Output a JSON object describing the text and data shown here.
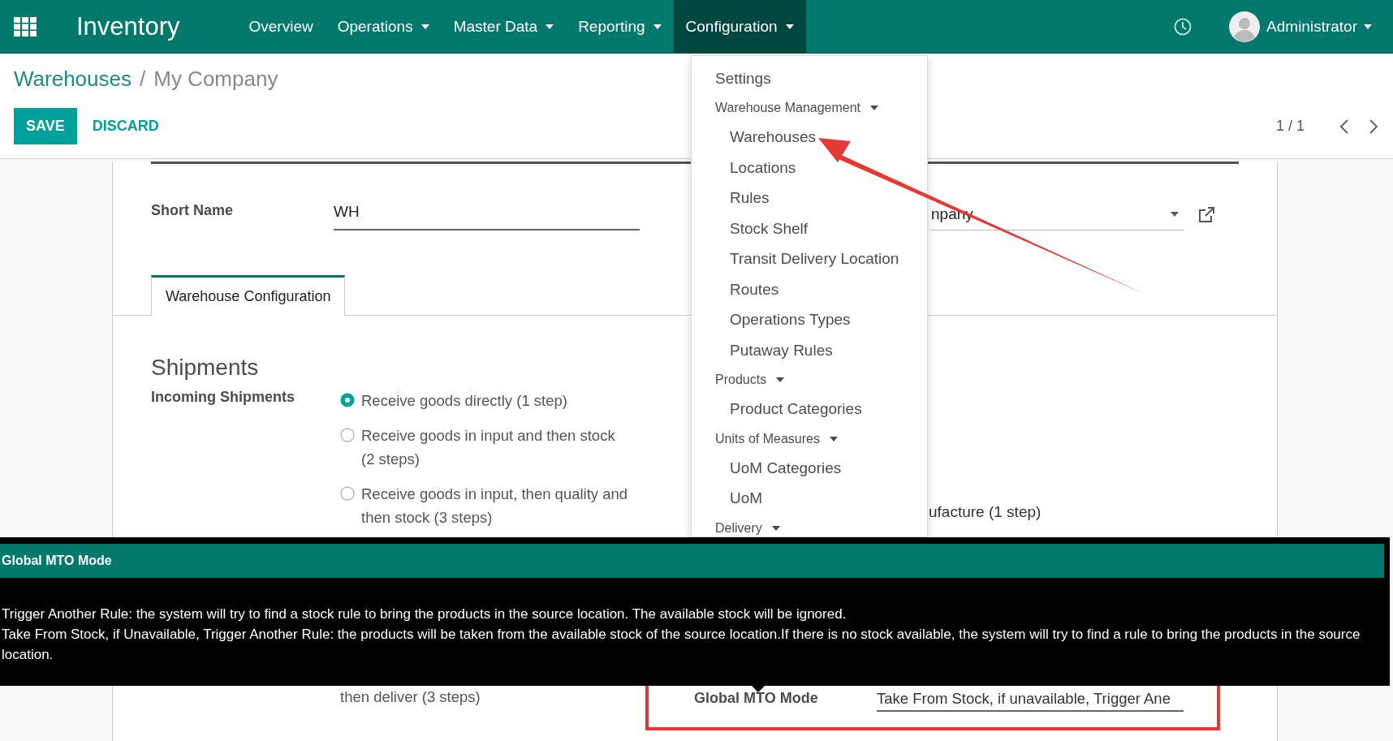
{
  "navbar": {
    "app_name": "Inventory",
    "menu": [
      {
        "label": "Overview",
        "has_caret": false,
        "selected": false
      },
      {
        "label": "Operations",
        "has_caret": true,
        "selected": false
      },
      {
        "label": "Master Data",
        "has_caret": true,
        "selected": false
      },
      {
        "label": "Reporting",
        "has_caret": true,
        "selected": false
      },
      {
        "label": "Configuration",
        "has_caret": true,
        "selected": true
      }
    ],
    "user": "Administrator"
  },
  "breadcrumb": {
    "parent": "Warehouses",
    "separator": "/",
    "current": "My Company"
  },
  "buttons": [
    {
      "label": "SAVE",
      "kind": "primary"
    },
    {
      "label": "DISCARD",
      "kind": "link"
    }
  ],
  "pager": "1 / 1",
  "form": {
    "short_name_label": "Short Name",
    "short_name_value": "WH",
    "company_value": "npany",
    "tabs": [
      {
        "label": "Warehouse Configuration",
        "selected": true
      }
    ],
    "section_title": "Shipments",
    "incoming_label": "Incoming Shipments",
    "incoming_options": [
      {
        "label": "Receive goods directly (1 step)",
        "selected": true
      },
      {
        "label": "Receive goods in input and then stock (2 steps)",
        "selected": false
      },
      {
        "label": "Receive goods in input, then quality and then stock (3 steps)",
        "selected": false
      }
    ],
    "manufacture_option": "ufacture (1 step)",
    "outgoing_option_tail": "then deliver (3 steps)",
    "mto_label": "Global MTO Mode",
    "mto_value": "Take From Stock, if unavailable, Trigger Ane"
  },
  "dropdown": {
    "items": [
      {
        "label": "Settings",
        "kind": "item"
      },
      {
        "label": "Warehouse Management",
        "kind": "header"
      },
      {
        "label": "Warehouses",
        "kind": "subitem"
      },
      {
        "label": "Locations",
        "kind": "subitem"
      },
      {
        "label": "Rules",
        "kind": "subitem"
      },
      {
        "label": "Stock Shelf",
        "kind": "subitem"
      },
      {
        "label": "Transit Delivery Location",
        "kind": "subitem"
      },
      {
        "label": "Routes",
        "kind": "subitem"
      },
      {
        "label": "Operations Types",
        "kind": "subitem"
      },
      {
        "label": "Putaway Rules",
        "kind": "subitem"
      },
      {
        "label": "Products",
        "kind": "header"
      },
      {
        "label": "Product Categories",
        "kind": "subitem"
      },
      {
        "label": "Units of Measures",
        "kind": "header"
      },
      {
        "label": "UoM Categories",
        "kind": "subitem"
      },
      {
        "label": "UoM",
        "kind": "subitem"
      },
      {
        "label": "Delivery",
        "kind": "header"
      }
    ]
  },
  "tooltip": {
    "title": "Global MTO Mode",
    "paragraphs": [
      "Trigger Another Rule: the system will try to find a stock rule to bring the products in the source location. The available stock will be ignored.",
      "Take From Stock, if Unavailable, Trigger Another Rule: the products will be taken from the available stock of the source location.If there is no stock available, the system will try to find a rule to bring the products in the source location."
    ]
  }
}
